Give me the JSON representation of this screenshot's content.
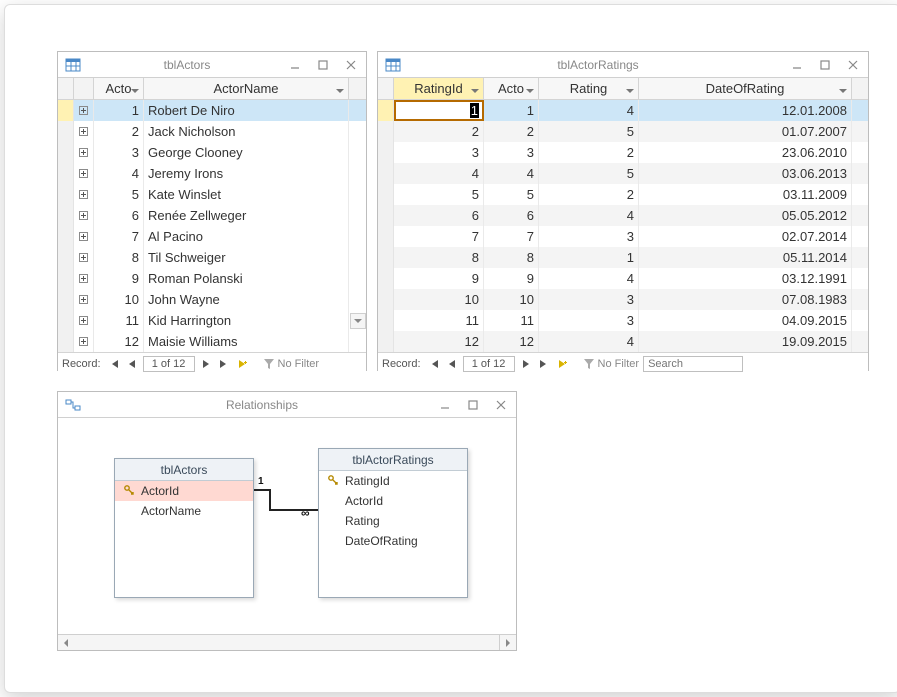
{
  "windows": {
    "actors": {
      "title": "tblActors",
      "columns": [
        "Acto",
        "ActorName"
      ],
      "rows": [
        {
          "id": 1,
          "name": "Robert De Niro"
        },
        {
          "id": 2,
          "name": "Jack Nicholson"
        },
        {
          "id": 3,
          "name": "George Clooney"
        },
        {
          "id": 4,
          "name": "Jeremy Irons"
        },
        {
          "id": 5,
          "name": "Kate Winslet"
        },
        {
          "id": 6,
          "name": "Renée Zellweger"
        },
        {
          "id": 7,
          "name": "Al Pacino"
        },
        {
          "id": 8,
          "name": "Til Schweiger"
        },
        {
          "id": 9,
          "name": "Roman Polanski"
        },
        {
          "id": 10,
          "name": "John Wayne"
        },
        {
          "id": 11,
          "name": "Kid Harrington"
        },
        {
          "id": 12,
          "name": "Maisie Williams"
        }
      ],
      "recnav": {
        "label": "Record:",
        "pos": "1 of 12",
        "filter": "No Filter"
      }
    },
    "ratings": {
      "title": "tblActorRatings",
      "columns": [
        "RatingId",
        "Acto",
        "Rating",
        "DateOfRating"
      ],
      "rows": [
        {
          "r": 1,
          "a": 1,
          "rt": 4,
          "d": "12.01.2008"
        },
        {
          "r": 2,
          "a": 2,
          "rt": 5,
          "d": "01.07.2007"
        },
        {
          "r": 3,
          "a": 3,
          "rt": 2,
          "d": "23.06.2010"
        },
        {
          "r": 4,
          "a": 4,
          "rt": 5,
          "d": "03.06.2013"
        },
        {
          "r": 5,
          "a": 5,
          "rt": 2,
          "d": "03.11.2009"
        },
        {
          "r": 6,
          "a": 6,
          "rt": 4,
          "d": "05.05.2012"
        },
        {
          "r": 7,
          "a": 7,
          "rt": 3,
          "d": "02.07.2014"
        },
        {
          "r": 8,
          "a": 8,
          "rt": 1,
          "d": "05.11.2014"
        },
        {
          "r": 9,
          "a": 9,
          "rt": 4,
          "d": "03.12.1991"
        },
        {
          "r": 10,
          "a": 10,
          "rt": 3,
          "d": "07.08.1983"
        },
        {
          "r": 11,
          "a": 11,
          "rt": 3,
          "d": "04.09.2015"
        },
        {
          "r": 12,
          "a": 12,
          "rt": 4,
          "d": "19.09.2015"
        }
      ],
      "recnav": {
        "label": "Record:",
        "pos": "1 of 12",
        "filter": "No Filter",
        "search": "Search"
      }
    },
    "relationships": {
      "title": "Relationships",
      "left_table": {
        "name": "tblActors",
        "fields": [
          "ActorId",
          "ActorName"
        ],
        "pk": "ActorId"
      },
      "right_table": {
        "name": "tblActorRatings",
        "fields": [
          "RatingId",
          "ActorId",
          "Rating",
          "DateOfRating"
        ],
        "pk": "RatingId"
      },
      "relation": {
        "left_card": "1",
        "right_card": "∞"
      }
    }
  },
  "chart_data": {
    "type": "table",
    "tables": [
      {
        "name": "tblActors",
        "columns": [
          "ActorId",
          "ActorName"
        ],
        "rows": [
          [
            1,
            "Robert De Niro"
          ],
          [
            2,
            "Jack Nicholson"
          ],
          [
            3,
            "George Clooney"
          ],
          [
            4,
            "Jeremy Irons"
          ],
          [
            5,
            "Kate Winslet"
          ],
          [
            6,
            "Renée Zellweger"
          ],
          [
            7,
            "Al Pacino"
          ],
          [
            8,
            "Til Schweiger"
          ],
          [
            9,
            "Roman Polanski"
          ],
          [
            10,
            "John Wayne"
          ],
          [
            11,
            "Kid Harrington"
          ],
          [
            12,
            "Maisie Williams"
          ]
        ]
      },
      {
        "name": "tblActorRatings",
        "columns": [
          "RatingId",
          "ActorId",
          "Rating",
          "DateOfRating"
        ],
        "rows": [
          [
            1,
            1,
            4,
            "12.01.2008"
          ],
          [
            2,
            2,
            5,
            "01.07.2007"
          ],
          [
            3,
            3,
            2,
            "23.06.2010"
          ],
          [
            4,
            4,
            5,
            "03.06.2013"
          ],
          [
            5,
            5,
            2,
            "03.11.2009"
          ],
          [
            6,
            6,
            4,
            "05.05.2012"
          ],
          [
            7,
            7,
            3,
            "02.07.2014"
          ],
          [
            8,
            8,
            1,
            "05.11.2014"
          ],
          [
            9,
            9,
            4,
            "03.12.1991"
          ],
          [
            10,
            10,
            3,
            "07.08.1983"
          ],
          [
            11,
            11,
            3,
            "04.09.2015"
          ],
          [
            12,
            12,
            4,
            "19.09.2015"
          ]
        ]
      }
    ],
    "relationship": {
      "from": "tblActors.ActorId",
      "to": "tblActorRatings.ActorId",
      "type": "one-to-many"
    }
  }
}
